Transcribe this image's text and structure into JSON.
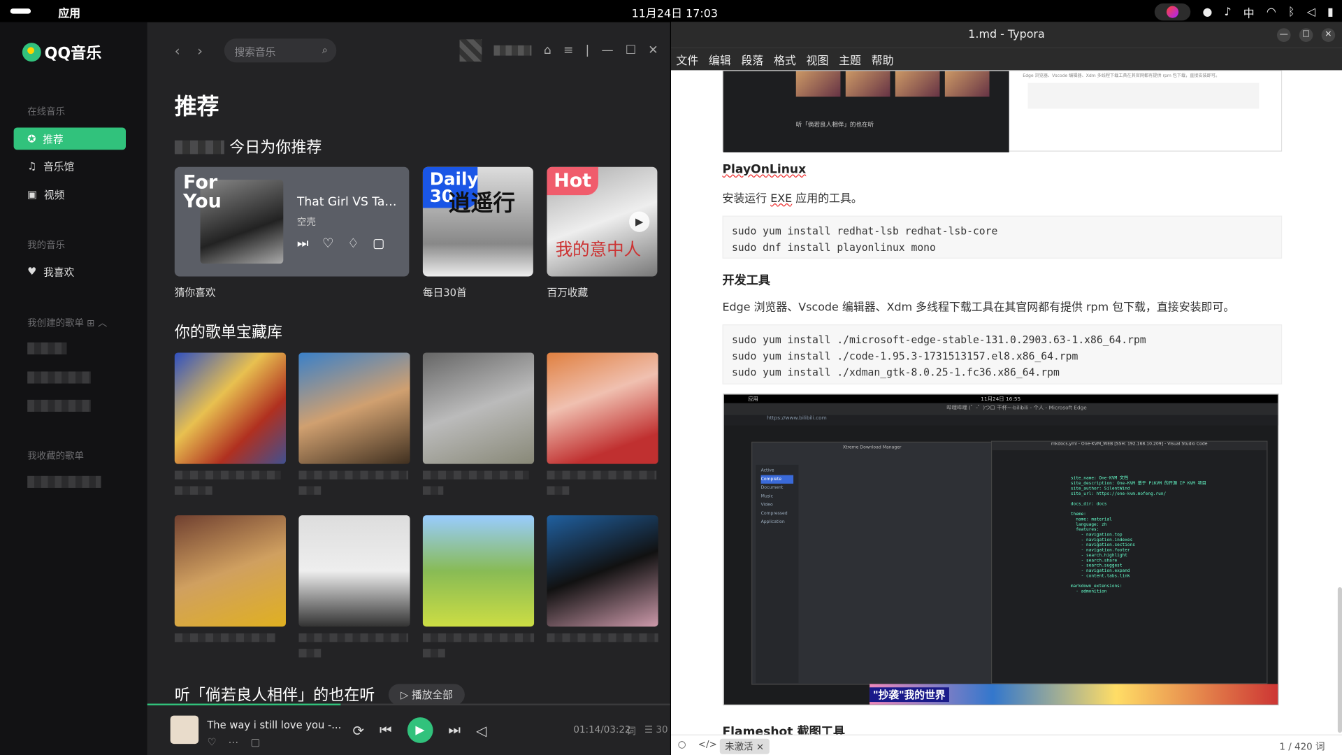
{
  "topbar": {
    "apps": "应用",
    "clock": "11月24日 17:03",
    "ime": "中"
  },
  "qq": {
    "logo": "QQ音乐",
    "sidebar": {
      "section_online": "在线音乐",
      "items": [
        {
          "label": "推荐"
        },
        {
          "label": "音乐馆"
        },
        {
          "label": "视频"
        }
      ],
      "section_mine": "我的音乐",
      "favorite": "我喜欢",
      "section_created": "我创建的歌单",
      "section_collected": "我收藏的歌单"
    },
    "search_placeholder": "搜索音乐",
    "page_title": "推荐",
    "today_header": "今日为你推荐",
    "guess": {
      "tag": "For You",
      "song": "That Girl VS Talki...",
      "artist": "空壳",
      "label": "猜你喜欢"
    },
    "daily": {
      "tag": "Daily 30",
      "art_text": "逍遥行",
      "label": "每日30首"
    },
    "hot": {
      "tag": "Hot",
      "art_text": "我的意中人",
      "label": "百万收藏"
    },
    "library_header": "你的歌单宝藏库",
    "listen_header": "听「倘若良人相伴」的也在听",
    "play_all": "播放全部",
    "player": {
      "title": "The way i still love you -...",
      "time": "01:14/03:22",
      "lyric": "词",
      "queue_count": "30",
      "progress": 0.37
    }
  },
  "typora": {
    "window_title": "1.md - Typora",
    "menu": [
      "文件",
      "编辑",
      "段落",
      "格式",
      "视图",
      "主题",
      "帮助"
    ],
    "h_playonlinux": "PlayOnLinux",
    "p_playonlinux_pre": "安装运行 ",
    "p_playonlinux_exe": "EXE",
    "p_playonlinux_post": " 应用的工具。",
    "code1": "sudo yum install redhat-lsb redhat-lsb-core\nsudo dnf install playonlinux mono",
    "h_devtools": "开发工具",
    "p_dev": "Edge 浏览器、Vscode 编辑器、Xdm 多线程下载工具在其官网都有提供 rpm 包下载，直接安装即可。",
    "code2": "sudo yum install ./microsoft-edge-stable-131.0.2903.63-1.x86_64.rpm\nsudo yum install ./code-1.95.3-1731513157.el8.x86_64.rpm\nsudo yum install ./xdman_gtk-8.0.25-1.fc36.x86_64.rpm",
    "h_flameshot": "Flameshot 截图工具",
    "shot1_text": "Edge 浏览器、Vscode 编辑器、Xdm 多线程下载工具在其官网都有提供 rpm 包下载，直接安装即可。",
    "shot1_song": "听「倘若良人相伴」的也在听",
    "shot2": {
      "apps": "应用",
      "clock": "11月24日 16:55",
      "tab": "哔哩哔哩 (゜-゜)つロ 干杯~-bilibili - 个人 - Microsoft Edge",
      "url": "https://www.bilibili.com",
      "xdm_title": "Xtreme Download Manager",
      "xdm_cats": [
        "Active",
        "Complete",
        "Document",
        "Music",
        "Video",
        "Compressed",
        "Application"
      ],
      "vscode_title": "mkdocs.yml - One-KVM_WEB [SSH: 192.168.10.209] - Visual Studio Code",
      "code": "site_name: One-KVM 文档\nsite_description: One-KVM 基于 PiKVM 的开源 IP KVM 项目\nsite_author: SilentWind\nsite_url: https://one-kvm.mofeng.run/\n\ndocs_dir: docs\n\ntheme:\n  name: material\n  language: zh\n  features:\n    - navigation.top\n    - navigation.indexes\n    - navigation.sections\n    - navigation.footer\n    - search.highlight\n    - search.share\n    - search.suggest\n    - navigation.expand\n    - content.tabs.link\n\nmarkdown_extensions:\n  - admonition",
      "banner": "\"抄袭\"我的世界"
    },
    "status": {
      "inactive": "未激活 ×",
      "word_count": "1 / 420 词"
    }
  }
}
